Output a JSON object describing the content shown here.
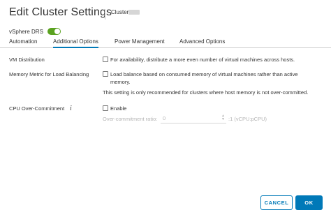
{
  "dialog": {
    "title": "Edit Cluster Settings",
    "cluster_name": "Cluster"
  },
  "drs": {
    "label": "vSphere DRS",
    "enabled": true
  },
  "tabs": [
    {
      "label": "Automation",
      "active": false
    },
    {
      "label": "Additional Options",
      "active": true
    },
    {
      "label": "Power Management",
      "active": false
    },
    {
      "label": "Advanced Options",
      "active": false
    }
  ],
  "options": {
    "vm_distribution": {
      "label": "VM Distribution",
      "checkbox_text": "For availability, distribute a more even number of virtual machines across hosts.",
      "checked": false
    },
    "memory_metric": {
      "label": "Memory Metric for Load Balancing",
      "checkbox_text_line1": "Load balance based on consumed memory of virtual machines rather than active",
      "checkbox_text_line2": "memory.",
      "note": "This setting is only recommended for clusters where host memory is not over-committed.",
      "checked": false
    },
    "cpu_overcommit": {
      "label": "CPU Over-Commitment",
      "info_icon": "info-icon",
      "checkbox_text": "Enable",
      "checked": false,
      "ratio_label": "Over-commitment ratio:",
      "ratio_value": "0",
      "ratio_unit": ":1 (vCPU:pCPU)"
    }
  },
  "footer": {
    "cancel_label": "CANCEL",
    "ok_label": "OK"
  },
  "colors": {
    "accent": "#0079b8",
    "toggle_on": "#5aa220"
  }
}
